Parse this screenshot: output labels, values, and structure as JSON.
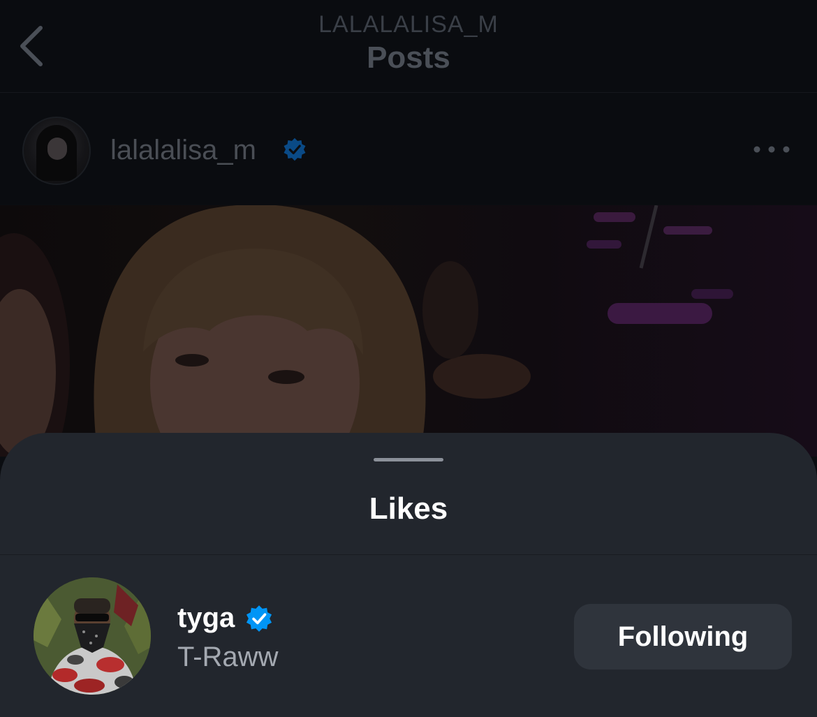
{
  "nav": {
    "username": "LALALALISA_M",
    "title": "Posts"
  },
  "post": {
    "username": "lalalalisa_m",
    "verified": true
  },
  "sheet": {
    "title": "Likes"
  },
  "likes": [
    {
      "username": "tyga",
      "full_name": "T-Raww",
      "verified": true,
      "button_label": "Following"
    }
  ],
  "colors": {
    "background": "#0b0d11",
    "sheet": "#22262d",
    "button": "#2f343c",
    "verified_blue": "#0095f6",
    "verified_blue_dimmed": "#0a4a86",
    "secondary_text": "#a4a9b1"
  },
  "icons": {
    "back": "chevron-left-icon",
    "verified": "verified-badge-icon",
    "more": "more-horizontal-icon"
  }
}
